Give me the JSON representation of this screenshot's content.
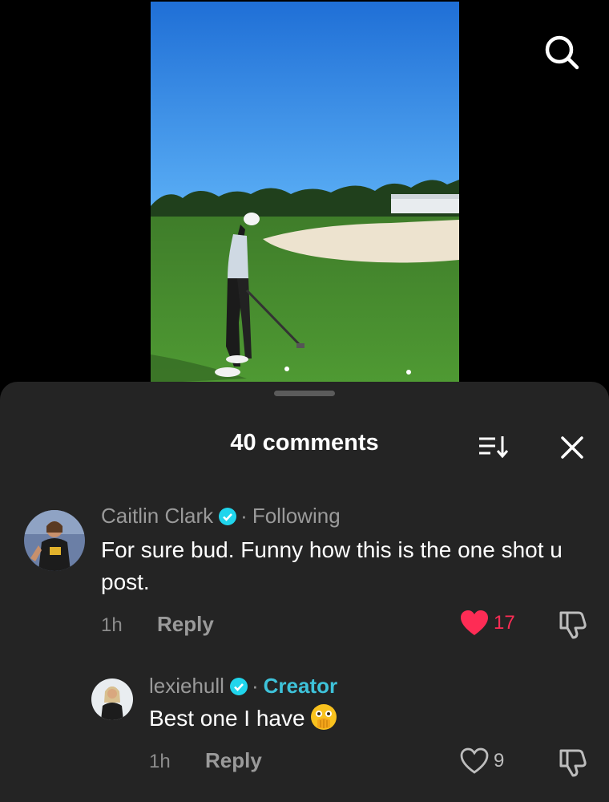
{
  "icons": {
    "search": "search-icon",
    "sort": "sort-icon",
    "close": "close-icon",
    "verified": "verified-badge-icon",
    "heart_filled": "heart-filled-icon",
    "heart_outline": "heart-outline-icon",
    "dislike": "dislike-icon",
    "emoji": "flushed-hand-over-mouth-emoji"
  },
  "colors": {
    "sheet_bg": "#242424",
    "liked_red": "#fe2c55",
    "creator_teal": "#3ec2d9",
    "verified_blue": "#20d5ec"
  },
  "sheet": {
    "title": "40 comments"
  },
  "comments": [
    {
      "username": "Caitlin Clark",
      "badge": "Following",
      "text": "For sure bud. Funny how this is the one shot u post.",
      "time": "1h",
      "reply_label": "Reply",
      "likes": "17",
      "liked": true
    },
    {
      "username": "lexiehull",
      "badge": "Creator",
      "text": "Best one I have",
      "time": "1h",
      "reply_label": "Reply",
      "likes": "9",
      "liked": false
    }
  ]
}
